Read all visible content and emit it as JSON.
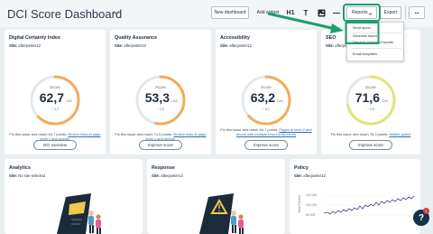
{
  "header": {
    "title": "DCI Score Dashboard",
    "new_dashboard": "New dashboard",
    "add_widget": "Add widget",
    "tool_h1": "H1",
    "tool_t": "T",
    "reports": "Reports",
    "export": "Export",
    "more": "•••"
  },
  "reports_menu": {
    "items": [
      "Send report",
      "Schedule report",
      "Manage scheduled reports",
      "Email templates"
    ]
  },
  "cards": [
    {
      "title": "Digital Certainty Index",
      "site_label": "Site:",
      "site": "afterposter12",
      "score_label": "Score",
      "score": "62,7",
      "max": "/100",
      "delta": "− 3,2",
      "score_fraction": 0.627,
      "color": "#f3ab5a",
      "desc_plain": "Fix this issue and reach 63,7 points: ",
      "desc_link": "Broken links at page level 1 and deeper",
      "button": "DCI overview"
    },
    {
      "title": "Quality Assurance",
      "site_label": "Site:",
      "site": "afterposter12",
      "score_label": "Score",
      "score": "53,3",
      "max": "/100",
      "delta": "− 2,6",
      "score_fraction": 0.533,
      "color": "#f3ab5a",
      "desc_plain": "Fix this issue and reach 74,5 points: ",
      "desc_link": "Broken links at page level 1 and deeper",
      "button": "Improve score"
    },
    {
      "title": "Accessibility",
      "site_label": "Site:",
      "site": "afterposter12",
      "score_label": "Score",
      "score": "63,2",
      "max": "/100",
      "delta": "− 8,2",
      "score_fraction": 0.632,
      "color": "#f3ab5a",
      "desc_plain": "Fix this issue and reach 94,7 points: ",
      "desc_link": "Pages at level 2 and above with multiple Level A/AA errors",
      "button": "Improve score"
    },
    {
      "title": "SEO",
      "site_label": "Site:",
      "site": "afterposter12",
      "score_label": "Score",
      "score": "71,6",
      "max": "/100",
      "delta": "− 0,5",
      "score_fraction": 0.716,
      "color": "#e0e37c",
      "desc_plain": "Fix this issue and reach 78,3 points: ",
      "desc_link": "Mobile speed",
      "button": "Improve score"
    }
  ],
  "bottom_cards": [
    {
      "title": "Analytics",
      "site_label": "Site:",
      "site": "No site selected"
    },
    {
      "title": "Response",
      "site_label": "Site:",
      "site": "afterposter12"
    },
    {
      "title": "Policy",
      "site_label": "Site:",
      "site": "afterposter12"
    }
  ],
  "policy_chart": {
    "yticks": [
      "120 000",
      "100 000",
      "80 000"
    ],
    "ylabel": "Total Policies"
  },
  "help": {
    "icon_text": "?",
    "badge": "1"
  },
  "colors": {
    "gauge_track": "#e4e8eb",
    "callout": "#1e9e6b",
    "accent_link": "#2b6fb6"
  }
}
